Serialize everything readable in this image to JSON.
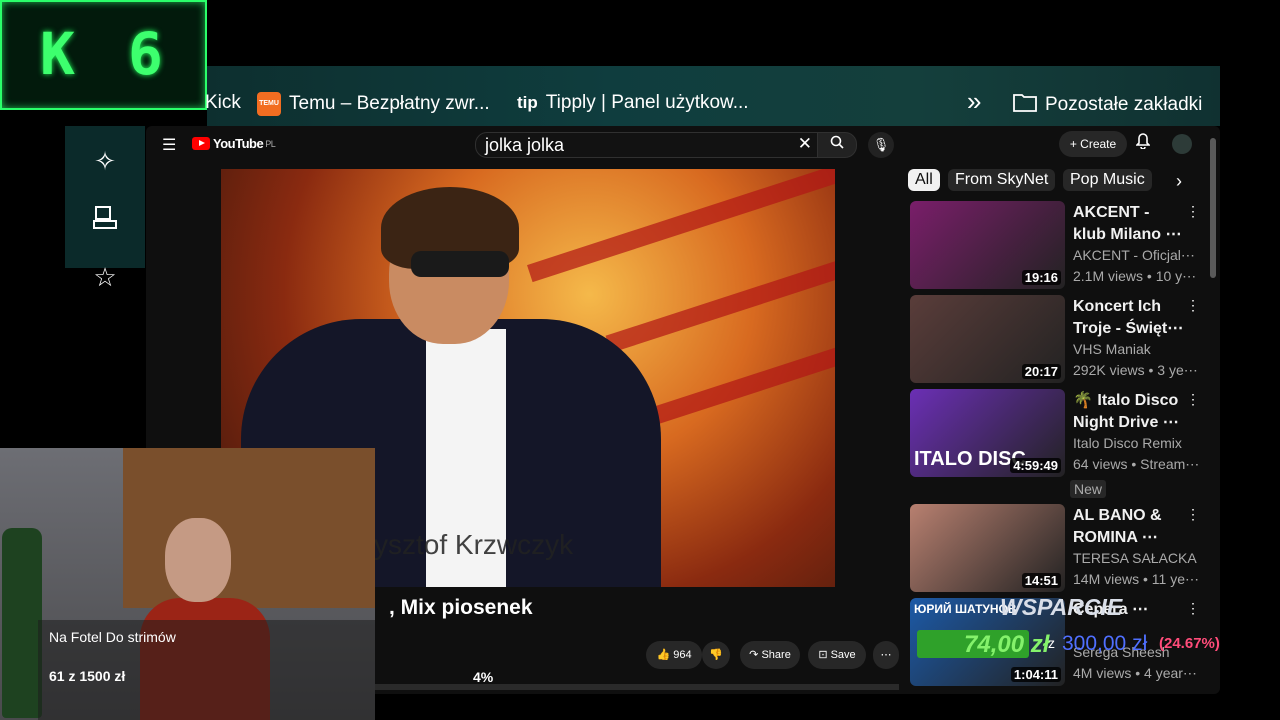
{
  "counter": {
    "letter": "K",
    "number": "6"
  },
  "bookmarks": {
    "kick": "Kick",
    "temu_icon": "TEMU",
    "temu": "Temu – Bezpłatny zwr...",
    "tipply_icon": "tip",
    "tipply": "Tipply | Panel użytkow...",
    "more": "»",
    "other": "Pozostałe zakładki"
  },
  "youtube": {
    "logo": "YouTube",
    "region": "PL",
    "search_value": "jolka jolka",
    "create_label": "Create",
    "video_caption": "zysztof Krzwczyk",
    "video_title_fragment": ", Mix piosenek",
    "actions": {
      "likes": "964",
      "share": "Share",
      "save": "Save"
    }
  },
  "chips": [
    "All",
    "From SkyNet",
    "Pop Music"
  ],
  "recommendations": [
    {
      "title": "AKCENT - klub Milano ⋯",
      "channel": "AKCENT - Oficjal⋯",
      "meta": "2.1M views • 10 y⋯",
      "duration": "19:16",
      "color": "#7a1e6a"
    },
    {
      "title": "Koncert Ich Troje - Święt⋯",
      "channel": "VHS Maniak",
      "meta": "292K views • 3 ye⋯",
      "duration": "20:17",
      "color": "#5a3d3a"
    },
    {
      "title": "🌴 Italo Disco Night Drive ⋯",
      "channel": "Italo Disco Remix",
      "meta": "64 views • Stream⋯",
      "duration": "4:59:49",
      "color": "#6b2fb5",
      "thumb_text": "ITALO DISC"
    },
    {
      "title": "AL BANO & ROMINA ⋯",
      "channel": "TERESA SAŁACKA",
      "meta": "14M views • 11 ye⋯",
      "duration": "14:51",
      "color": "#b88070"
    },
    {
      "title": "Серега ⋯",
      "channel": "Serega Sheesh",
      "meta": "4M views • 4 year⋯",
      "duration": "1:04:11",
      "color": "#1c5aa8",
      "thumb_text": "ЮРИЙ ШАТУНОВ"
    }
  ],
  "new_badge": "New",
  "donation": {
    "title": "Na Fotel Do strimów",
    "progress": "61  z  1500  zł",
    "percent": "4%"
  },
  "wsparcie": {
    "title": "WSPARCIE",
    "current": "74,00 zł",
    "sep": "z",
    "goal": "300,00 zł",
    "percent": "(24.67%)"
  }
}
